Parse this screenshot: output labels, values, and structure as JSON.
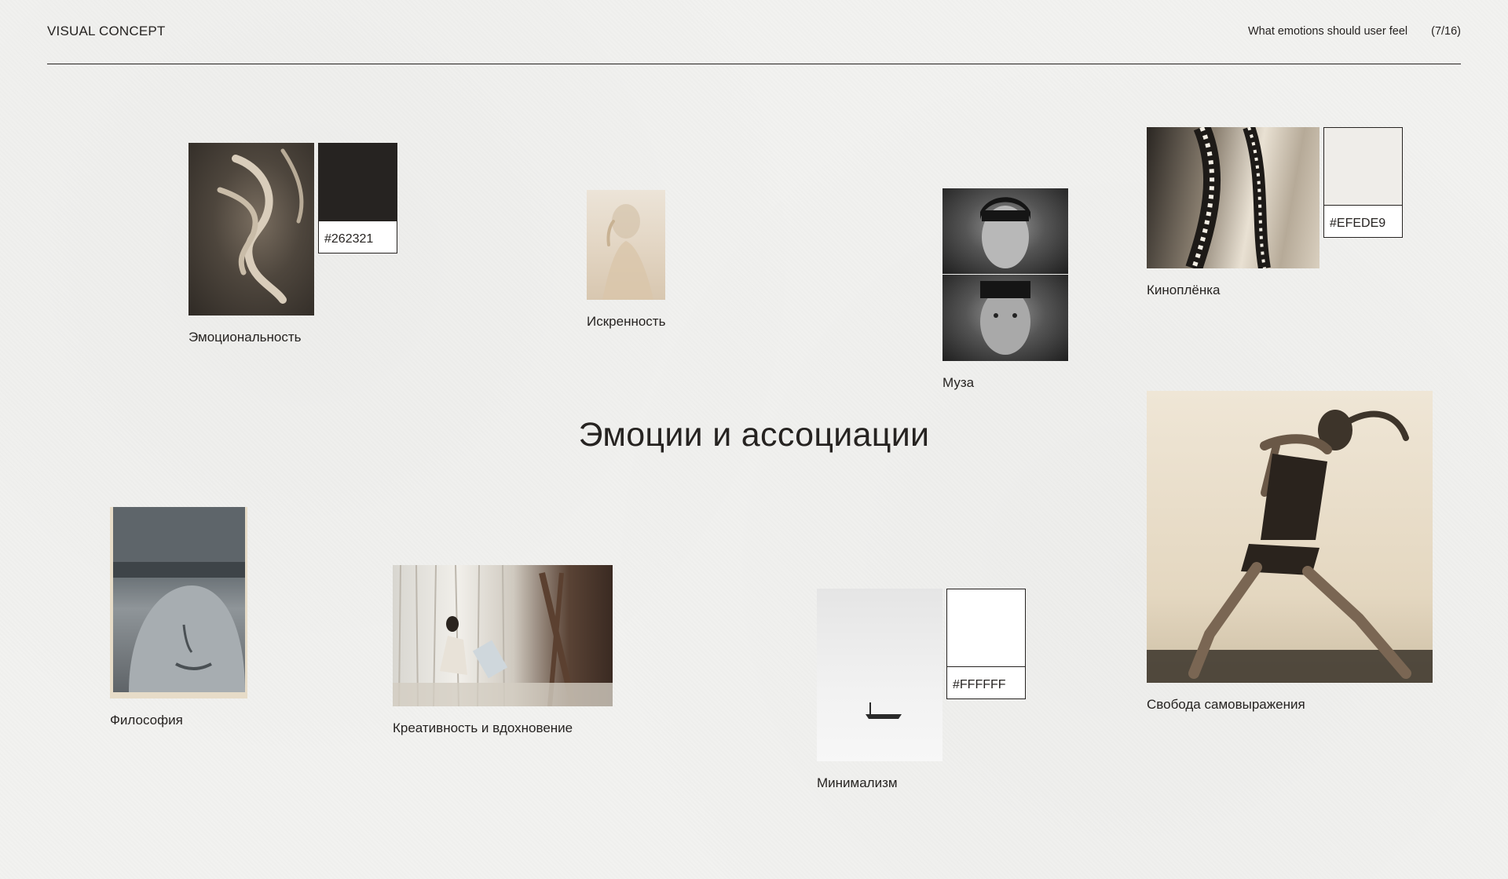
{
  "header": {
    "brand": "VISUAL CONCEPT",
    "section": "What emotions should user feel",
    "page": "(7/16)"
  },
  "title": "Эмоции и ассоциации",
  "items": {
    "emotionality": {
      "caption": "Эмоциональность",
      "swatch": "#262321"
    },
    "sincerity": {
      "caption": "Искренность"
    },
    "muse": {
      "caption": "Муза"
    },
    "film": {
      "caption": "Киноплёнка",
      "swatch": "#EFEDE9"
    },
    "freedom": {
      "caption": "Свобода самовыражения"
    },
    "philosophy": {
      "caption": "Философия"
    },
    "creativity": {
      "caption": "Креативность и вдохновение"
    },
    "minimalism": {
      "caption": "Минимализм",
      "swatch": "#FFFFFF"
    }
  }
}
